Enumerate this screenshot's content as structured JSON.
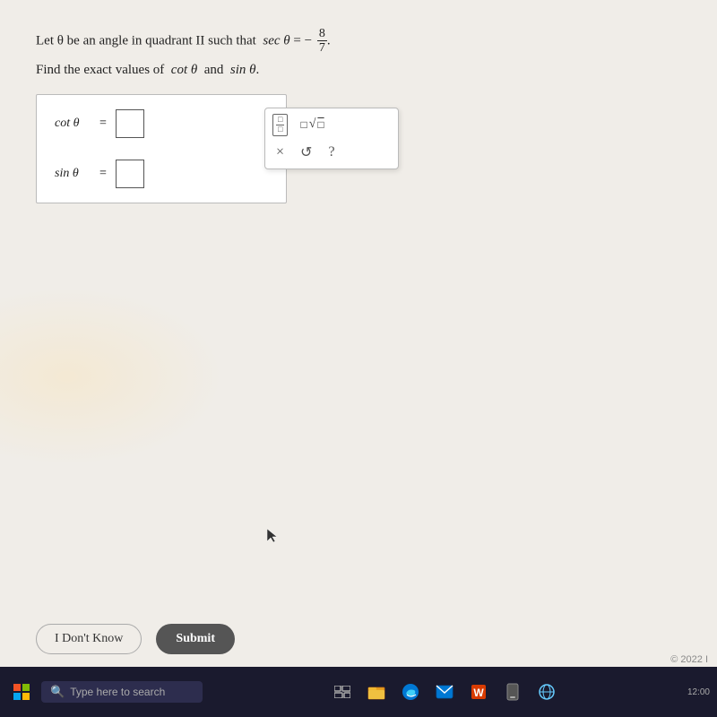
{
  "problem": {
    "intro": "Let θ be an angle in quadrant II such that",
    "sec_label": "sec θ = −",
    "fraction": {
      "num": "8",
      "den": "7"
    },
    "find_text": "Find the exact values of",
    "cot_label": "cot θ",
    "sin_label": "sin θ",
    "and_text": "and",
    "dot_text": "."
  },
  "answer_labels": {
    "cot": "cot θ",
    "cot_equals": "=",
    "sin": "sin θ",
    "sin_equals": "="
  },
  "toolbar": {
    "fraction_num": "□",
    "fraction_den": "□",
    "sqrt_box": "□",
    "sqrt_sym": "√□",
    "x_label": "×",
    "undo_label": "↺",
    "help_label": "?"
  },
  "buttons": {
    "dont_know": "I Don't Know",
    "submit": "Submit"
  },
  "taskbar": {
    "search_placeholder": "Type here to search",
    "copyright": "© 2022 I"
  }
}
